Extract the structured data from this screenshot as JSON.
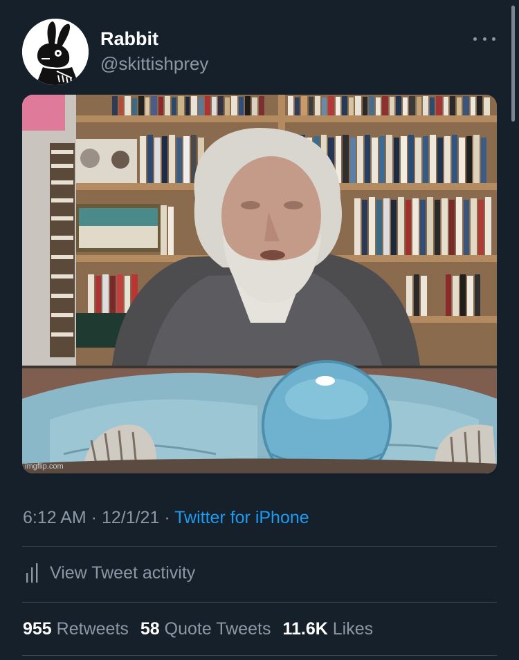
{
  "tweet": {
    "author": {
      "display_name": "Rabbit",
      "handle": "@skittishprey"
    },
    "media": {
      "watermark": "imgflip.com"
    },
    "meta": {
      "time": "6:12 AM",
      "separator": " · ",
      "date": "12/1/21",
      "source": "Twitter for iPhone"
    },
    "activity": {
      "label": "View Tweet activity",
      "icon": "analytics-bars-icon"
    },
    "stats": [
      {
        "number": "955",
        "label": "Retweets"
      },
      {
        "number": "58",
        "label": "Quote Tweets"
      },
      {
        "number": "11.6K",
        "label": "Likes"
      }
    ]
  },
  "colors": {
    "background": "#15202b",
    "primary_text": "#ffffff",
    "secondary_text": "#8b98a5",
    "link": "#1d9bf0",
    "divider": "#38444d"
  }
}
